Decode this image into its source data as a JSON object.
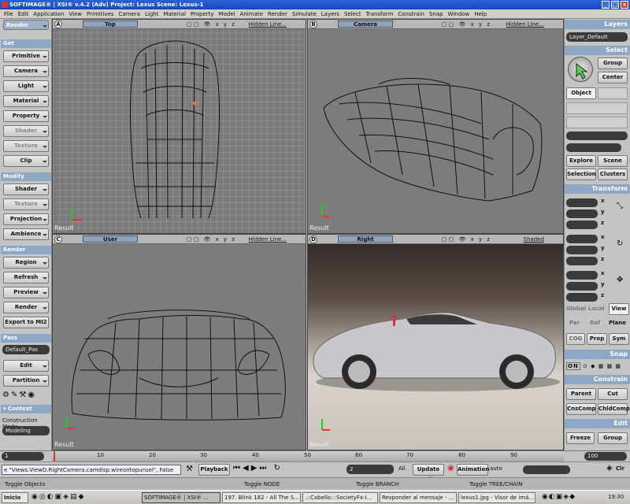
{
  "titlebar": {
    "text": "SOFTIMAGE® | XSI® v.4.2 (Adv) Project: Lexus    Scene: Lexus-1"
  },
  "menu": [
    "File",
    "Edit",
    "Application",
    "View",
    "Primitives",
    "Camera",
    "Light",
    "Material",
    "Property",
    "Model",
    "Animate",
    "Render",
    "Simulate",
    "Layers",
    "Select",
    "Transform",
    "Constrain",
    "Snap",
    "Window",
    "Help"
  ],
  "left": {
    "render_title": "Render",
    "get_title": "Get",
    "get_buttons": [
      "Primitive",
      "Camera",
      "Light",
      "Material",
      "Property",
      "Shader",
      "Texture",
      "Clip"
    ],
    "modify_title": "Modify",
    "modify_buttons": [
      "Shader",
      "Texture",
      "Projection",
      "Ambience"
    ],
    "render2_title": "Render",
    "render_buttons": [
      "Region",
      "Refresh",
      "Preview",
      "Render",
      "Export to MI2"
    ],
    "pass_title": "Pass",
    "pass_value": "Default_Pas",
    "pass_buttons": [
      "Edit",
      "Partition"
    ],
    "context_title": "Context",
    "construction_label": "Construction Mode",
    "construction_value": "Modeling"
  },
  "viewports": [
    {
      "letter": "A",
      "camera": "Top",
      "mode": "Hidden Line...",
      "result": "Result"
    },
    {
      "letter": "B",
      "camera": "Camera",
      "mode": "Hidden Line...",
      "result": "Result"
    },
    {
      "letter": "C",
      "camera": "User",
      "mode": "Hidden Line...",
      "result": "Result"
    },
    {
      "letter": "D",
      "camera": "Right",
      "mode": "Shaded",
      "result": "Result"
    }
  ],
  "right": {
    "layers_title": "Layers",
    "layer_value": "Layer_Default",
    "select_title": "Select",
    "select_buttons": {
      "group": "Group",
      "center": "Center",
      "object": "Object"
    },
    "explore": "Explore",
    "scene": "Scene",
    "selection": "Selection",
    "clusters": "Clusters",
    "transform_title": "Transform",
    "axes": [
      "x",
      "y",
      "z"
    ],
    "global": "Global",
    "local": "Local",
    "view": "View",
    "par": "Par",
    "ref": "Ref",
    "plane": "Plane",
    "cog": "COG",
    "prop": "Prop",
    "sym": "Sym",
    "snap_title": "Snap",
    "snap_on": "ON",
    "constrain_title": "Constrain",
    "parent": "Parent",
    "cut": "Cut",
    "cnscomp": "CnsComp",
    "chldcomp": "ChldComp",
    "edit_title": "Edit",
    "freeze": "Freeze",
    "group": "Group"
  },
  "timeline": {
    "start": "1",
    "end": "100",
    "ticks": [
      "10",
      "20",
      "30",
      "40",
      "50",
      "60",
      "70",
      "80",
      "90"
    ]
  },
  "playbar": {
    "command": "e \"Views.ViewD.RightCamera.camdisp.wireontopunsel\", False",
    "playback": "Playback",
    "frame": "2",
    "all": "All",
    "update": "Update All",
    "animation": "Animation",
    "auto": "auto",
    "clr": "Clr"
  },
  "statusbar": {
    "left": "Toggle Objects",
    "mid1": "Toggle NODE",
    "mid2": "Toggle BRANCH",
    "right": "Toggle TREE/CHAIN"
  },
  "taskbar": {
    "start": "Inicio",
    "tasks": [
      "SOFTIMAGE® | XSI® ...",
      "197. Blink 182 - All The S...",
      ".::Cabello:::SocietyFx-I...",
      "Responder al mensaje - ...",
      "lexus1.jpg - Visor de imá..."
    ],
    "clock": "19:30"
  }
}
